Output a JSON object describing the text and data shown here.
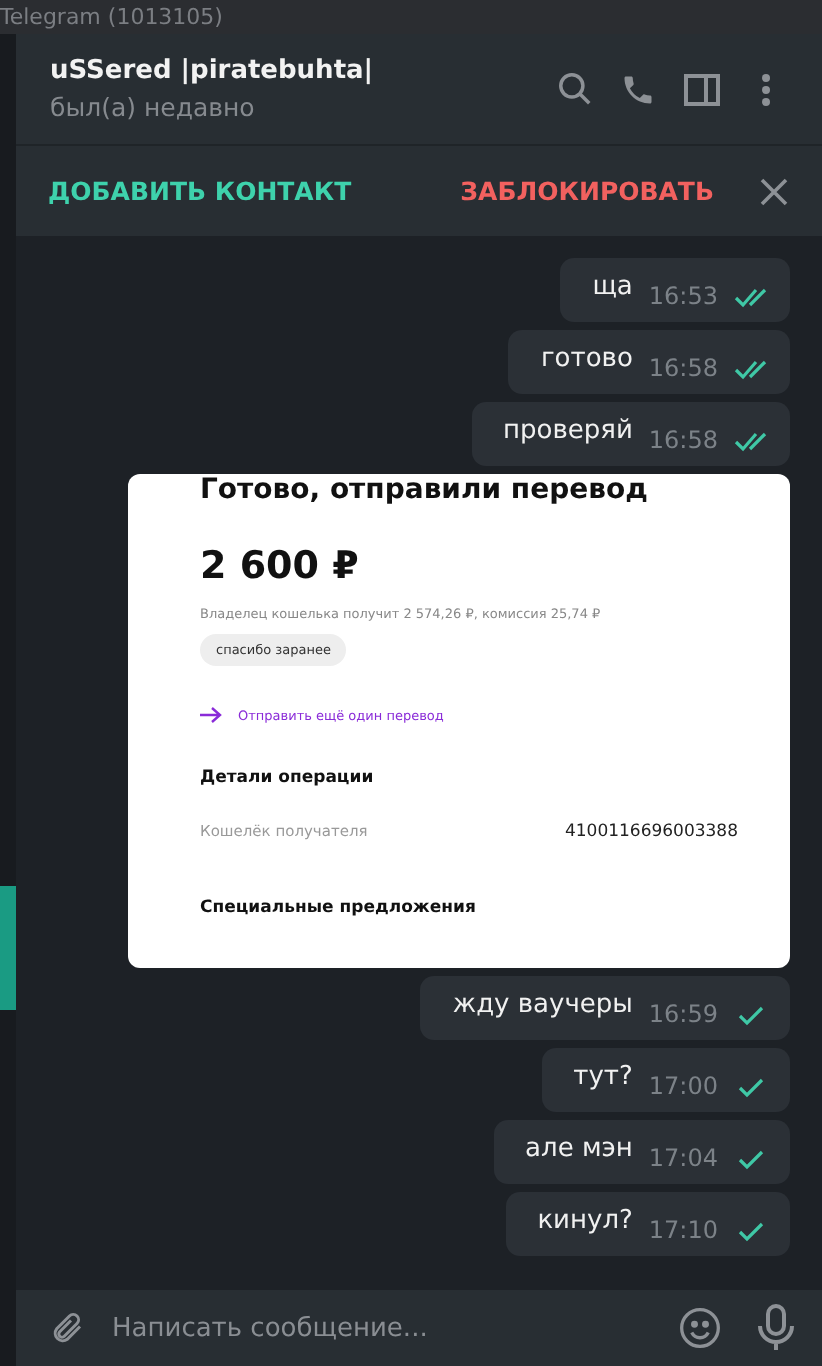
{
  "window": {
    "title": "Telegram (1013105)"
  },
  "chat_header": {
    "name": "uSSered |piratebuhta|",
    "status": "был(а) недавно"
  },
  "action_bar": {
    "add_contact": "ДОБАВИТЬ КОНТАКТ",
    "block": "ЗАБЛОКИРОВАТЬ"
  },
  "messages": [
    {
      "kind": "text",
      "text": "ща",
      "time": "16:53",
      "read": true
    },
    {
      "kind": "text",
      "text": "готово",
      "time": "16:58",
      "read": true
    },
    {
      "kind": "text",
      "text": "проверяй",
      "time": "16:58",
      "read": true
    },
    {
      "kind": "receipt",
      "title": "Готово, отправили перевод",
      "amount": "2 600 ₽",
      "note": "Владелец кошелька получит 2 574,26 ₽, комиссия 25,74 ₽",
      "comment": "спасибо заранее",
      "link": "Отправить ещё один перевод",
      "details_title": "Детали операции",
      "detail_label": "Кошелёк получателя",
      "detail_value": "4100116696003388",
      "offers_title": "Специальные предложения"
    },
    {
      "kind": "text",
      "text": "жду ваучеры",
      "time": "16:59",
      "read": false
    },
    {
      "kind": "text",
      "text": "тут?",
      "time": "17:00",
      "read": false
    },
    {
      "kind": "text",
      "text": "але мэн",
      "time": "17:04",
      "read": false
    },
    {
      "kind": "text",
      "text": "кинул?",
      "time": "17:10",
      "read": false
    }
  ],
  "composer": {
    "placeholder": "Написать сообщение..."
  }
}
